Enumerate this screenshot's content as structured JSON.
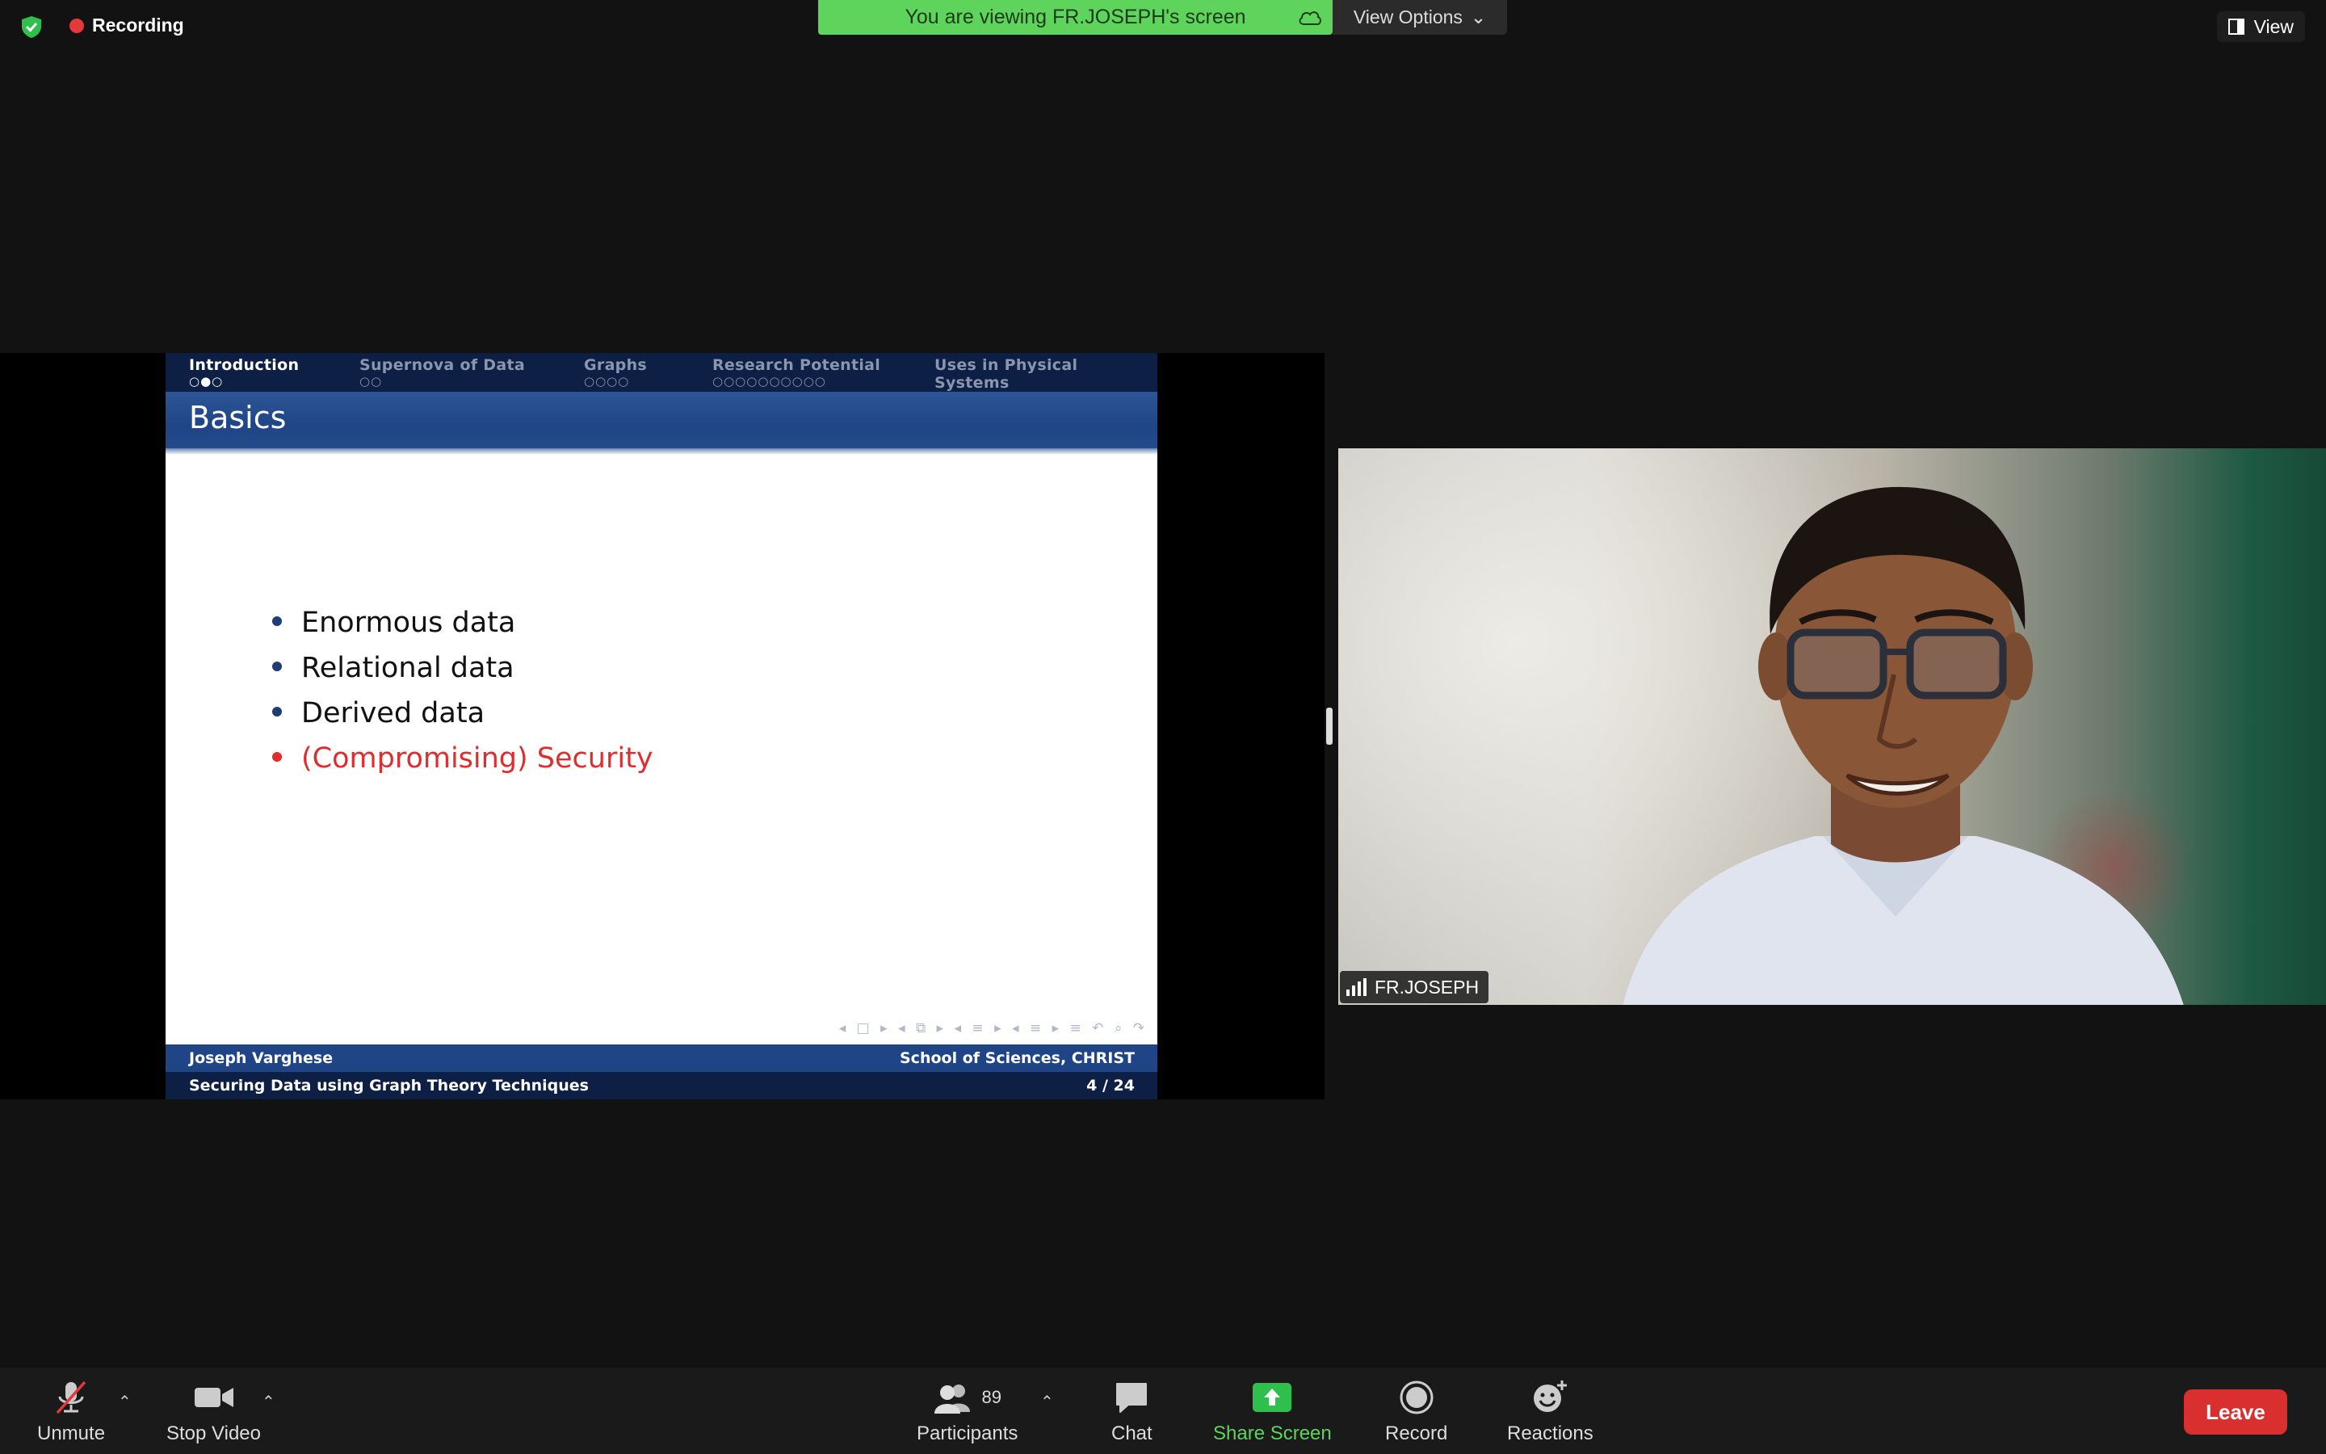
{
  "top": {
    "recording_label": "Recording",
    "banner_text": "You are viewing FR.JOSEPH's screen",
    "view_options_label": "View Options",
    "view_label": "View"
  },
  "slide": {
    "nav": [
      {
        "label": "Introduction",
        "dots": "○●○",
        "active": true
      },
      {
        "label": "Supernova of Data",
        "dots": "○○",
        "active": false
      },
      {
        "label": "Graphs",
        "dots": "○○○○",
        "active": false
      },
      {
        "label": "Research Potential",
        "dots": "○○○○○○○○○○",
        "active": false
      },
      {
        "label": "Uses in Physical Systems",
        "dots": "○○○",
        "active": false
      }
    ],
    "title": "Basics",
    "bullets": [
      "Enormous data",
      "Relational data",
      "Derived data",
      "(Compromising) Security"
    ],
    "nav_symbols": "◂ □ ▸  ◂ ⧉ ▸  ◂ ≡ ▸  ◂ ≡ ▸   ≡   ↶ ⌕ ↷",
    "footer": {
      "author": "Joseph Varghese",
      "institute": "School of Sciences, CHRIST",
      "talk_title": "Securing Data using Graph Theory Techniques",
      "page": "4 / 24"
    }
  },
  "video": {
    "participant_name": "FR.JOSEPH"
  },
  "toolbar": {
    "unmute_label": "Unmute",
    "stop_video_label": "Stop Video",
    "participants_label": "Participants",
    "participants_count": "89",
    "chat_label": "Chat",
    "share_label": "Share Screen",
    "record_label": "Record",
    "reactions_label": "Reactions",
    "leave_label": "Leave"
  },
  "colors": {
    "banner_green": "#5ed45c",
    "recording_red": "#e5383b",
    "leave_red": "#d9302f",
    "slide_blue": "#1f4586",
    "slide_navy": "#0d1f45",
    "alert_red": "#e02c2c"
  }
}
